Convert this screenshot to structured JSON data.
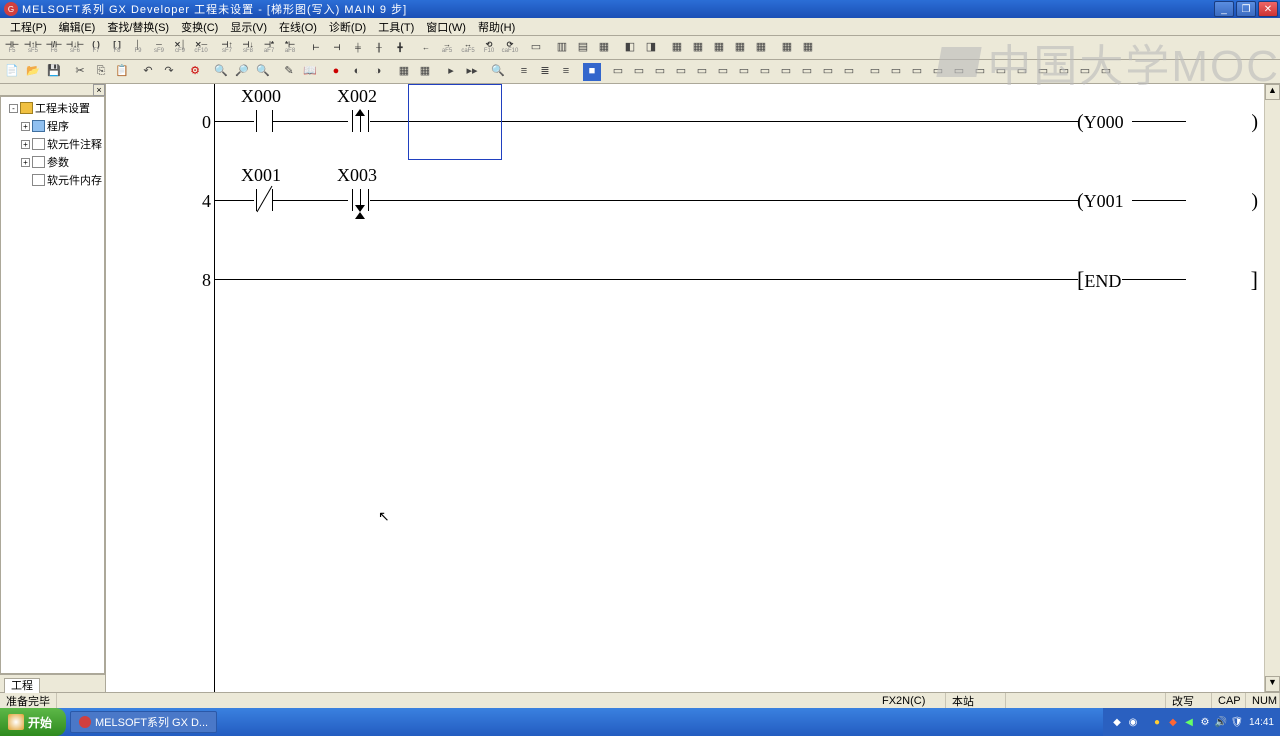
{
  "title": "MELSOFT系列 GX Developer 工程未设置 - [梯形图(写入)    MAIN    9 步]",
  "menu": [
    "工程(P)",
    "编辑(E)",
    "查找/替换(S)",
    "变换(C)",
    "显示(V)",
    "在线(O)",
    "诊断(D)",
    "工具(T)",
    "窗口(W)",
    "帮助(H)"
  ],
  "tb1_labels": [
    "F5",
    "sF5",
    "F6",
    "sF6",
    "F7",
    "F8",
    "F9",
    "sF9",
    "cF9",
    "cF10",
    "sF7",
    "sF8",
    "aF7",
    "aF8",
    "sF5",
    "cF5",
    "F10",
    "aF5",
    "caF5",
    "caF10"
  ],
  "tree": {
    "root": "工程未设置",
    "items": [
      "程序",
      "软元件注释",
      "参数",
      "软元件内存"
    ]
  },
  "tree_tab": "工程",
  "ladder": {
    "rung0": {
      "step": "0",
      "c1": "X000",
      "c2": "X002",
      "coil": "Y000"
    },
    "rung1": {
      "step": "4",
      "c1": "X001",
      "c2": "X003",
      "coil": "Y001"
    },
    "rung2": {
      "step": "8",
      "end": "END"
    }
  },
  "status": {
    "left": "准备完毕",
    "plc": "FX2N(C)",
    "station": "本站",
    "mode": "改写",
    "caps": "CAP",
    "num": "NUM"
  },
  "taskbar": {
    "start": "开始",
    "app": "MELSOFT系列 GX D...",
    "clock": "14:41"
  },
  "watermark": "中国大学MOC"
}
